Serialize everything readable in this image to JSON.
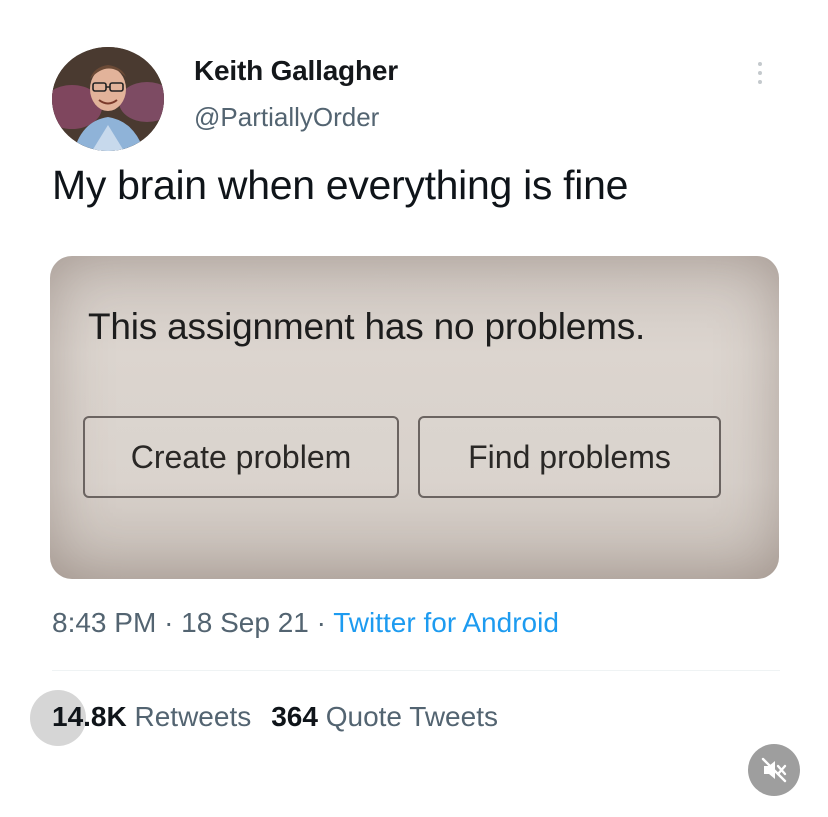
{
  "tweet": {
    "display_name": "Keith Gallagher",
    "handle": "@PartiallyOrder",
    "text": "My brain when everything is fine",
    "media": {
      "message": "This assignment has no problems.",
      "buttons": [
        "Create problem",
        "Find problems"
      ]
    },
    "time": "8:43 PM",
    "date": "18 Sep 21",
    "separator": "·",
    "source": "Twitter for Android",
    "stats": {
      "retweets_count": "14.8K",
      "retweets_label": "Retweets",
      "quotes_count": "364",
      "quotes_label": "Quote Tweets"
    }
  },
  "icons": {
    "more": "more-vertical-icon",
    "mute": "mute-icon"
  },
  "colors": {
    "accent": "#1d9bf0",
    "secondary_text": "#536471",
    "primary_text": "#0f1419"
  }
}
